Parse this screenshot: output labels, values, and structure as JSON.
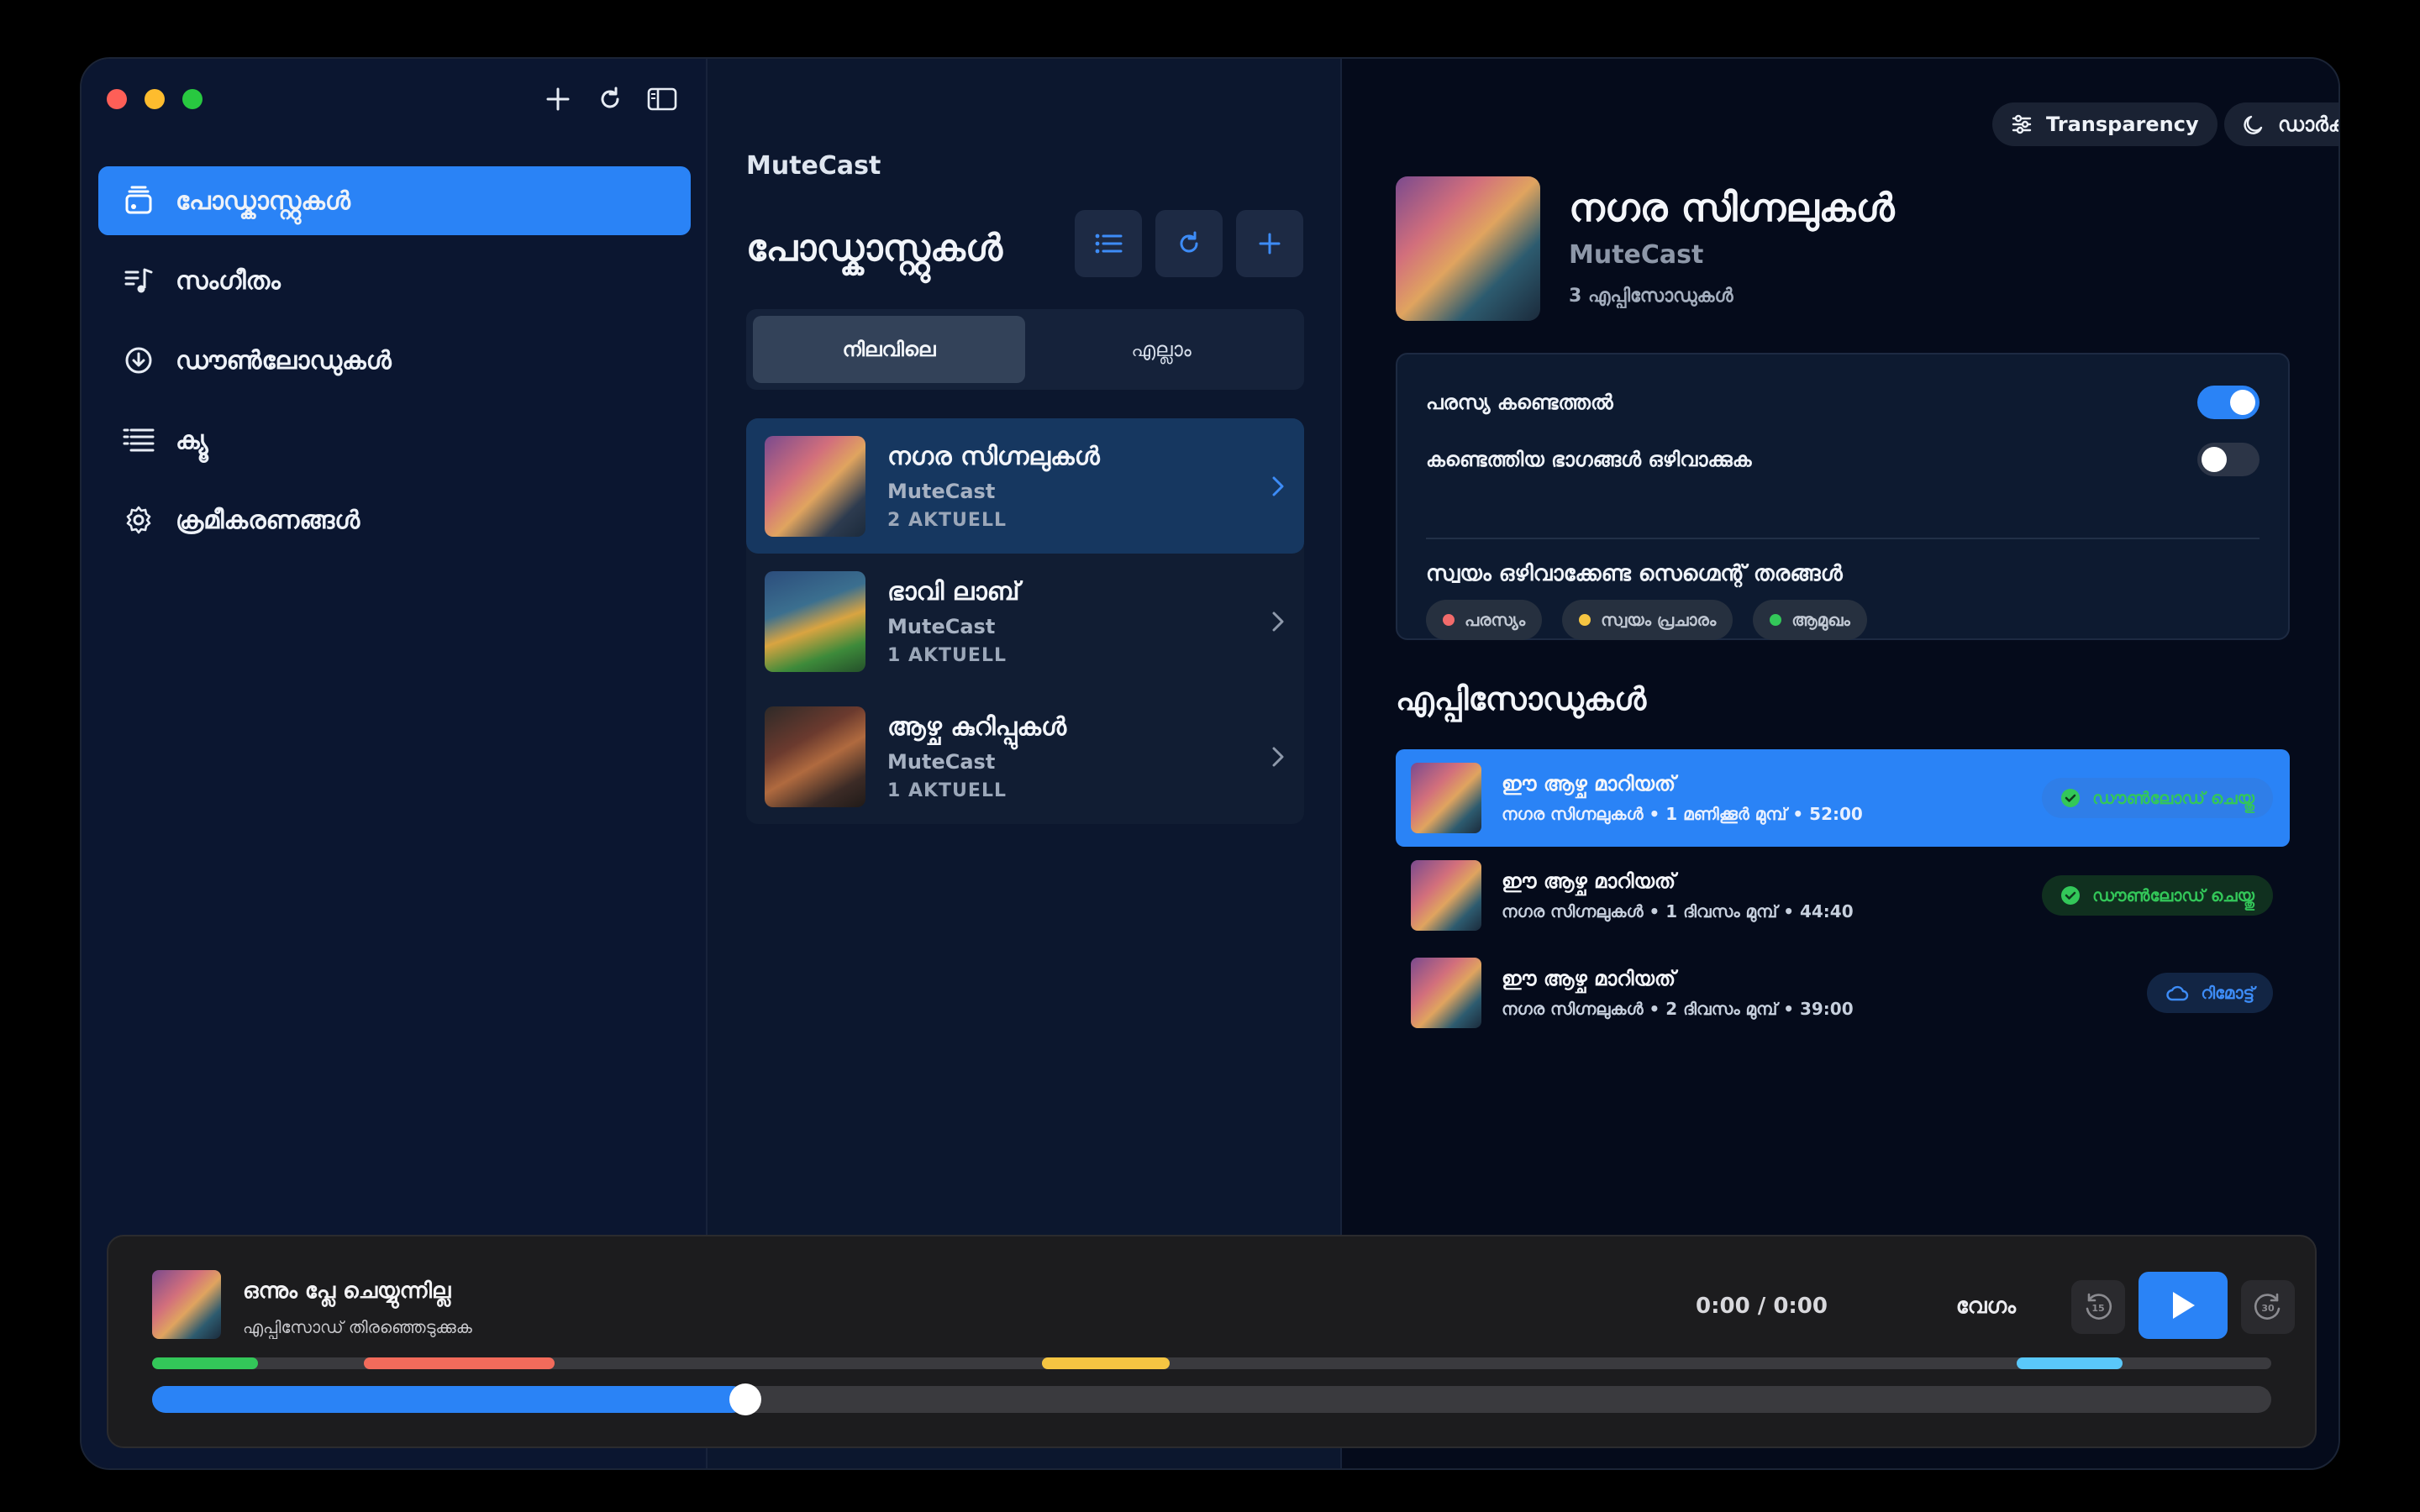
{
  "sidebar": {
    "items": [
      {
        "label": "പോഡ്കാസ്റ്റുകൾ",
        "icon": "podcast-stack-icon",
        "active": true
      },
      {
        "label": "സംഗീതം",
        "icon": "music-list-icon"
      },
      {
        "label": "ഡൗൺലോഡുകൾ",
        "icon": "download-circle-icon"
      },
      {
        "label": "ക്യൂ",
        "icon": "queue-list-icon"
      },
      {
        "label": "ക്രമീകരണങ്ങൾ",
        "icon": "gear-icon"
      }
    ]
  },
  "middle": {
    "app_name": "MuteCast",
    "title": "പോഡ്കാസ്റ്റുകൾ",
    "segments": [
      "നിലവിലെ",
      "എല്ലാം"
    ],
    "podcasts": [
      {
        "title": "നഗര സിഗ്നലുകൾ",
        "author": "MuteCast",
        "count": "2 AKTUELL"
      },
      {
        "title": "ഭാവി ലാബ്",
        "author": "MuteCast",
        "count": "1 AKTUELL"
      },
      {
        "title": "ആഴ്ച കുറിപ്പുകൾ",
        "author": "MuteCast",
        "count": "1 AKTUELL"
      }
    ]
  },
  "right": {
    "transparency_label": "Transparency",
    "theme_label": "ഡാർക്ക്",
    "podcast_title": "നഗര സിഗ്നലുകൾ",
    "podcast_author": "MuteCast",
    "episode_count": "3 എപ്പിസോഡുകൾ",
    "settings": {
      "ad_detect_label": "പരസ്യ കണ്ടെത്തൽ",
      "ad_detect_on": true,
      "skip_detected_label": "കണ്ടെത്തിയ ഭാഗങ്ങൾ ഒഴിവാക്കുക",
      "skip_detected_on": false,
      "auto_skip_heading": "സ്വയം ഒഴിവാക്കേണ്ട സെഗ്മെന്റ് തരങ്ങൾ",
      "chips": [
        {
          "label": "പരസ്യം",
          "color": "#f26b6b"
        },
        {
          "label": "സ്വയം പ്രചാരം",
          "color": "#f5c542"
        },
        {
          "label": "ആമുഖം",
          "color": "#33c759"
        }
      ]
    },
    "episodes_heading": "എപ്പിസോഡുകൾ",
    "episodes": [
      {
        "title": "ഈ ആഴ്ച മാറിയത്",
        "meta": "നഗര സിഗ്നലുകൾ • 1 മണിക്കൂർ മുമ്പ് • 52:00",
        "status": "ഡൗൺലോഡ് ചെയ്തു",
        "status_type": "downloaded"
      },
      {
        "title": "ഈ ആഴ്ച മാറിയത്",
        "meta": "നഗര സിഗ്നലുകൾ • 1 ദിവസം മുമ്പ് • 44:40",
        "status": "ഡൗൺലോഡ് ചെയ്തു",
        "status_type": "downloaded"
      },
      {
        "title": "ഈ ആഴ്ച മാറിയത്",
        "meta": "നഗര സിഗ്നലുകൾ • 2 ദിവസം മുമ്പ് • 39:00",
        "status": "റിമോട്ട്",
        "status_type": "remote"
      }
    ]
  },
  "player": {
    "title": "ഒന്നും പ്ലേ ചെയ്യുന്നില്ല",
    "subtitle": "എപ്പിസോഡ് തിരഞ്ഞെടുക്കുക",
    "time": "0:00 / 0:00",
    "speed_label": "വേഗം",
    "skip_back": "15",
    "skip_forward": "30",
    "progress": 0.28,
    "segments": [
      {
        "start": 0.0,
        "end": 0.05,
        "color": "#33c759"
      },
      {
        "start": 0.1,
        "end": 0.19,
        "color": "#f26b5b"
      },
      {
        "start": 0.42,
        "end": 0.48,
        "color": "#f5c542"
      },
      {
        "start": 0.88,
        "end": 0.93,
        "color": "#5ac8fa"
      }
    ]
  },
  "colors": {
    "accent": "#2a83f6",
    "downloaded": "#33c759"
  }
}
